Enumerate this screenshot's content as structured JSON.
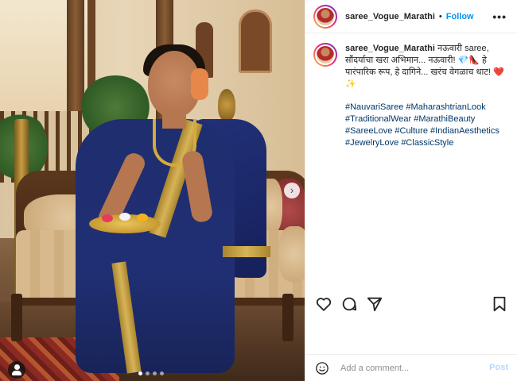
{
  "post": {
    "username": "saree_Vogue_Marathi",
    "separator": "•",
    "follow_label": "Follow",
    "more_label": "•••",
    "caption": "नऊवारी saree, सौंदर्याचा खरा अभिमान... नऊवारी! 💎👠 हे पारंपारिक रूप, हे दागिने... खरंच वेगळाच थाट! ❤️✨",
    "hashtags": "#NauvariSaree #MaharashtrianLook #TraditionalWear #MarathiBeauty #SareeLove #Culture #IndianAesthetics #JewelryLove #ClassicStyle"
  },
  "actions": {
    "like_icon": "heart-icon",
    "comment_icon": "comment-icon",
    "share_icon": "share-icon",
    "save_icon": "bookmark-icon"
  },
  "comment": {
    "placeholder": "Add a comment...",
    "post_label": "Post",
    "emoji_icon": "smiley-icon"
  },
  "media": {
    "next_label": "›",
    "slides": 4,
    "active_slide": 1
  },
  "colors": {
    "follow": "#0095f6",
    "hashtag": "#00376b",
    "post_disabled": "#b3dbff"
  }
}
